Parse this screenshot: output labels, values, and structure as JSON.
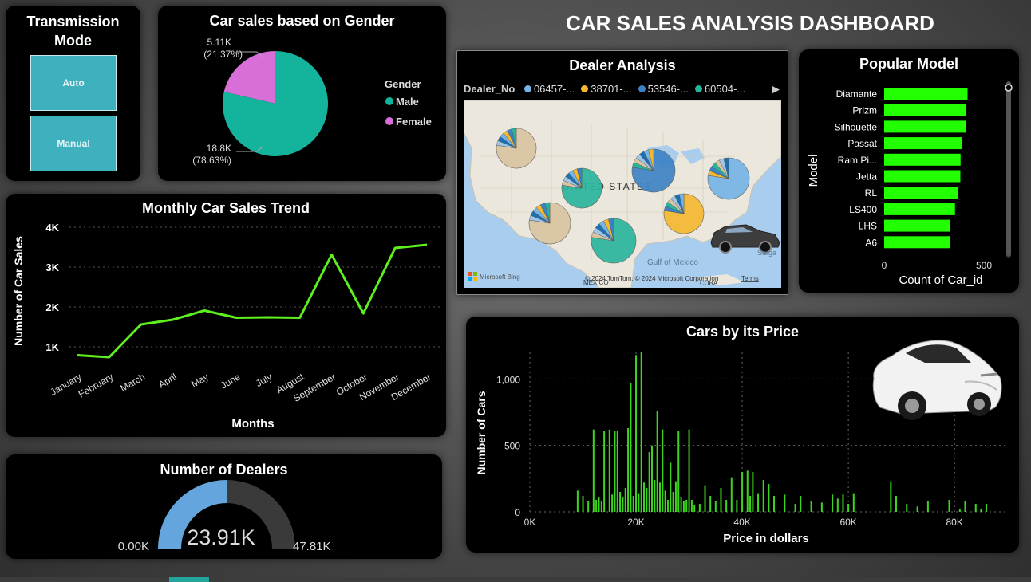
{
  "dashboard": {
    "title": "CAR SALES ANALYSIS DASHBOARD"
  },
  "transmission": {
    "title": "Transmission Mode",
    "options": [
      "Auto",
      "Manual"
    ],
    "color": "#3fb0be"
  },
  "gender_chart": {
    "title": "Car sales based on Gender",
    "legend_title": "Gender",
    "female_label": "5.11K",
    "female_pct": "(21.37%)",
    "male_label": "18.8K",
    "male_pct": "(78.63%)",
    "colors": {
      "male": "#13b39c",
      "female": "#d86fd8"
    }
  },
  "trend": {
    "title": "Monthly Car Sales Trend",
    "xlabel": "Months",
    "ylabel": "Number of Car Sales",
    "line_color": "#5ef01e"
  },
  "dealers": {
    "title": "Number of Dealers",
    "value": "23.91K",
    "min_label": "0.00K",
    "max_label": "47.81K",
    "fraction": 0.5,
    "colors": {
      "fill": "#63a5dc",
      "track": "#3a3a3a"
    }
  },
  "dealer_map": {
    "title": "Dealer Analysis",
    "legend_title": "Dealer_No",
    "legend_items": [
      {
        "label": "06457-...",
        "color": "#74b4e6"
      },
      {
        "label": "38701-...",
        "color": "#f5b82e"
      },
      {
        "label": "53546-...",
        "color": "#3b82c4"
      },
      {
        "label": "60504-...",
        "color": "#26b59c"
      }
    ],
    "country_label": "UNITED STATES",
    "gulf_label": "Gulf of Mexico",
    "mexico_label": "MEXICO",
    "cuba_label": "CUBA",
    "brand": "Microsoft Bing",
    "copyright": "© 2024 TomTom, © 2024 Microsoft Corporation",
    "terms": "Terms",
    "sarga": "Sarga"
  },
  "popular_model": {
    "title": "Popular Model",
    "xlabel": "Count of Car_id",
    "ylabel": "Model",
    "bar_color": "#22ff00"
  },
  "price_chart": {
    "title": "Cars by its Price",
    "xlabel": "Price in dollars",
    "ylabel": "Number of Cars",
    "bar_color": "#3cd41e"
  },
  "chart_data": [
    {
      "type": "pie",
      "title": "Car sales based on Gender",
      "categories": [
        "Male",
        "Female"
      ],
      "values": [
        18800,
        5110
      ],
      "percent": [
        78.63,
        21.37
      ]
    },
    {
      "type": "line",
      "title": "Monthly Car Sales Trend",
      "xlabel": "Months",
      "ylabel": "Number of Car Sales",
      "categories": [
        "January",
        "February",
        "March",
        "April",
        "May",
        "June",
        "July",
        "August",
        "September",
        "October",
        "November",
        "December"
      ],
      "values": [
        790,
        740,
        1560,
        1680,
        1910,
        1730,
        1740,
        1730,
        3310,
        1840,
        3480,
        3560
      ],
      "ylim": [
        500,
        4000
      ],
      "yticks": [
        "1K",
        "2K",
        "3K",
        "4K"
      ],
      "grid": true
    },
    {
      "type": "bar",
      "orientation": "horizontal",
      "title": "Popular Model",
      "xlabel": "Count of Car_id",
      "ylabel": "Model",
      "categories": [
        "Diamante",
        "Prizm",
        "Silhouette",
        "Passat",
        "Ram Pi...",
        "Jetta",
        "RL",
        "LS400",
        "LHS",
        "A6"
      ],
      "values": [
        418,
        411,
        411,
        391,
        383,
        382,
        372,
        355,
        332,
        329
      ],
      "xlim": [
        0,
        600
      ],
      "xticks": [
        "0",
        "500"
      ]
    },
    {
      "type": "bar",
      "title": "Cars by its Price",
      "xlabel": "Price in dollars",
      "ylabel": "Number of Cars",
      "x": [
        9000,
        10000,
        11000,
        12000,
        12500,
        13000,
        13500,
        14000,
        15000,
        15500,
        16000,
        16500,
        17000,
        17500,
        18000,
        18500,
        19000,
        19500,
        20000,
        20500,
        21000,
        21500,
        22000,
        22500,
        23000,
        23500,
        24000,
        24500,
        25000,
        25500,
        26000,
        26500,
        27000,
        27500,
        28000,
        28500,
        29000,
        29500,
        30000,
        30500,
        31000,
        32000,
        33000,
        34000,
        35000,
        36000,
        37000,
        38000,
        39000,
        40000,
        41000,
        41500,
        42000,
        43000,
        44000,
        45000,
        46000,
        48000,
        50000,
        51000,
        53000,
        55000,
        57000,
        58000,
        59000,
        60000,
        61000,
        68000,
        69000,
        71000,
        73000,
        75000,
        79000,
        81000,
        82000,
        84000,
        85000,
        86000
      ],
      "values": [
        160,
        120,
        80,
        620,
        90,
        110,
        80,
        610,
        620,
        130,
        610,
        610,
        150,
        110,
        180,
        630,
        970,
        120,
        1180,
        140,
        1200,
        220,
        180,
        450,
        500,
        240,
        760,
        220,
        620,
        160,
        90,
        370,
        150,
        230,
        610,
        110,
        80,
        90,
        620,
        90,
        50,
        60,
        200,
        120,
        80,
        180,
        90,
        260,
        90,
        300,
        310,
        120,
        300,
        140,
        240,
        210,
        120,
        130,
        60,
        120,
        80,
        70,
        130,
        100,
        130,
        60,
        140,
        230,
        120,
        60,
        40,
        80,
        90,
        20,
        80,
        60,
        20,
        60
      ],
      "xlim": [
        0,
        90000
      ],
      "ylim": [
        0,
        1200
      ],
      "xticks": [
        "0K",
        "20K",
        "40K",
        "60K",
        "80K"
      ],
      "yticks": [
        "0",
        "500",
        "1,000"
      ]
    }
  ]
}
